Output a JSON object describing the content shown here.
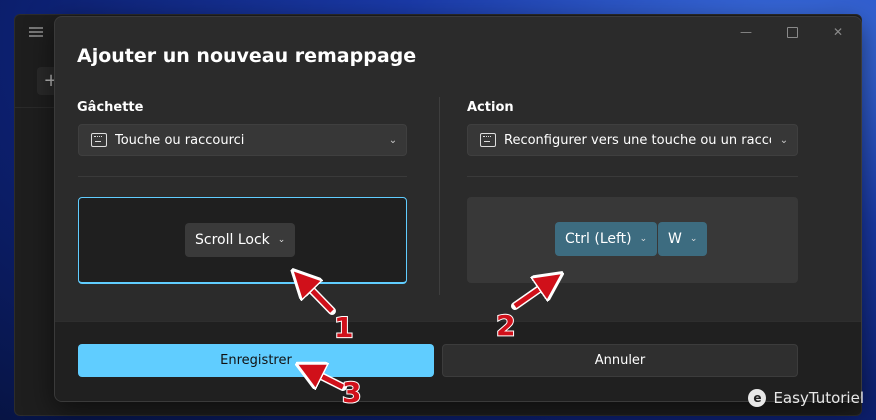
{
  "dialog": {
    "title": "Ajouter un nouveau remappage"
  },
  "trigger": {
    "label": "Gâchette",
    "dropdown_value": "Touche ou raccourci",
    "key": "Scroll Lock"
  },
  "action": {
    "label": "Action",
    "dropdown_value": "Reconfigurer vers une touche ou un racco",
    "keys": [
      "Ctrl (Left)",
      "W"
    ]
  },
  "buttons": {
    "save": "Enregistrer",
    "cancel": "Annuler"
  },
  "annotations": {
    "marker_1": "1",
    "marker_2": "2",
    "marker_3": "3",
    "arrow_color": "#d0101a"
  },
  "watermark": {
    "brand": "EasyTutoriel",
    "logo_letter": "e"
  },
  "icons": [
    "keyboard-icon",
    "chevron-down-icon",
    "close-icon",
    "minimize-icon",
    "maximize-icon",
    "add-icon",
    "menu-icon"
  ]
}
